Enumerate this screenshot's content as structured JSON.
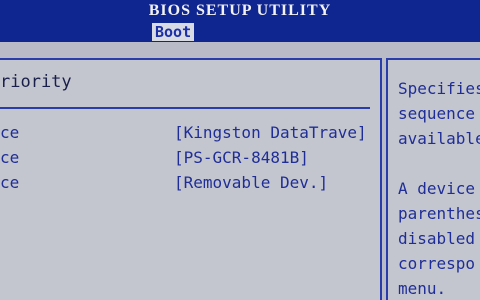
{
  "header": {
    "title": "BIOS SETUP UTILITY"
  },
  "menu": {
    "active_tab": "Boot"
  },
  "main": {
    "section_heading": "riority",
    "rows": [
      {
        "label": "ce",
        "value": "[Kingston DataTrave]"
      },
      {
        "label": "ce",
        "value": "[PS-GCR-8481B]"
      },
      {
        "label": "ce",
        "value": "[Removable Dev.]"
      }
    ]
  },
  "help": {
    "lines_top": [
      "Specifies",
      "sequence",
      "available"
    ],
    "lines_bottom": [
      "A device",
      "parenthes",
      "disabled",
      "correspo",
      "menu."
    ]
  },
  "colors": {
    "background": "#0b1a66",
    "title_bar": "#0f2590",
    "panel": "#c4c6cf",
    "text_blue": "#1f2e96",
    "border_blue": "#2a3caa",
    "selected_tab_bg": "#d9dbe4"
  }
}
